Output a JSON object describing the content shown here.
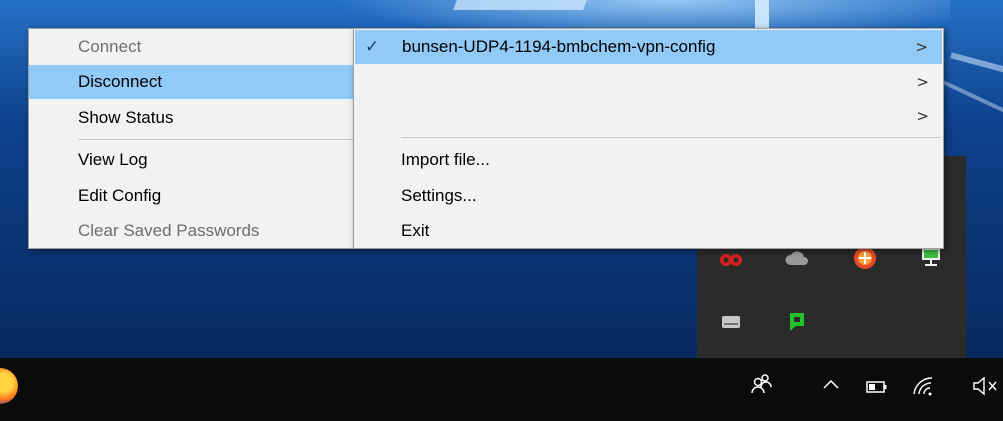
{
  "left_menu": {
    "items": [
      {
        "label": "Connect",
        "disabled": true
      },
      {
        "label": "Disconnect",
        "highlighted": true
      },
      {
        "label": "Show Status"
      },
      {
        "label": "View Log"
      },
      {
        "label": "Edit Config"
      },
      {
        "label": "Clear Saved Passwords",
        "disabled": true
      }
    ]
  },
  "right_menu": {
    "connections": [
      {
        "label": "bunsen-UDP4-1194-bmbchem-vpn-config",
        "checked": true
      },
      {
        "label": ""
      },
      {
        "label": ""
      }
    ],
    "actions": [
      {
        "label": "Import file..."
      },
      {
        "label": "Settings..."
      },
      {
        "label": "Exit"
      }
    ],
    "check_glyph": "✓",
    "submenu_arrow": ">"
  },
  "colors": {
    "menu_background": "#f2f2f2",
    "highlight": "#91c9f7",
    "disabled_text": "#6d6d6d",
    "taskbar": "#0b0b0b",
    "tray_overflow": "#2b2b2b"
  },
  "tray_overflow_icons": [
    "hardware-monitor-icon",
    "onedrive-cloud-icon",
    "network-security-icon",
    "display-network-icon",
    "removable-drive-icon",
    "green-chat-icon"
  ],
  "taskbar_icons": [
    "firefox-icon",
    "people-icon",
    "show-hidden-icons-chevron",
    "battery-icon",
    "wifi-icon",
    "volume-muted-icon"
  ]
}
